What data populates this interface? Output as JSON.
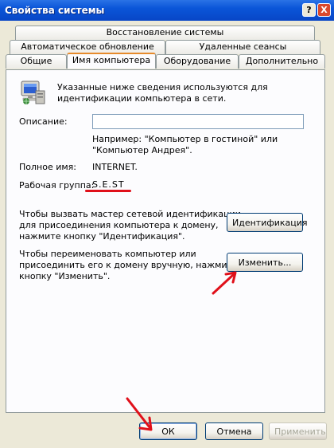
{
  "window": {
    "title": "Свойства системы",
    "help_glyph": "?",
    "close_glyph": "X"
  },
  "tabs": {
    "row1": [
      "Восстановление системы"
    ],
    "row2": [
      "Автоматическое обновление",
      "Удаленные сеансы"
    ],
    "row3": [
      "Общие",
      "Имя компьютера",
      "Оборудование",
      "Дополнительно"
    ],
    "active": "Имя компьютера"
  },
  "panel": {
    "intro": [
      "Указанные ниже сведения используются для",
      "идентификации компьютера в сети."
    ],
    "description_label": "Описание:",
    "description_value": "",
    "hint": [
      "Например: \"Компьютер в гостиной\" или",
      "\"Компьютер Андрея\"."
    ],
    "full_name_label": "Полное имя:",
    "full_name_value": "INTERNET.",
    "workgroup_label": "Рабочая группа:",
    "workgroup_value": "S.E.ST",
    "wizard_text": [
      "Чтобы вызвать мастер сетевой идентификации",
      "для присоединения компьютера к домену,",
      "нажмите кнопку \"Идентификация\"."
    ],
    "identification_button": "Идентификация",
    "rename_text": [
      "Чтобы переименовать компьютер или",
      "присоединить его к домену вручную, нажмите",
      "кнопку \"Изменить\"."
    ],
    "change_button": "Изменить..."
  },
  "footer": {
    "ok": "ОК",
    "cancel": "Отмена",
    "apply": "Применить"
  },
  "annotation_color": "#e0101a"
}
